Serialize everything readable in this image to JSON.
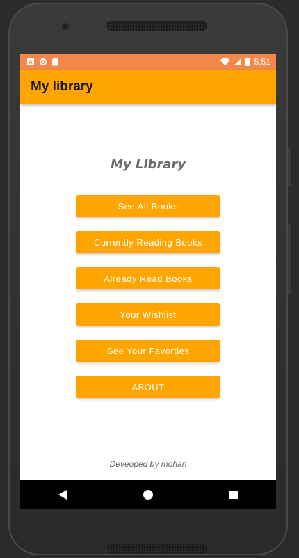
{
  "status_bar": {
    "time": "5:51",
    "left_icons": [
      "a-notification-icon",
      "record-icon",
      "sd-card-icon"
    ],
    "right_icons": [
      "wifi-icon",
      "signal-icon",
      "battery-icon"
    ]
  },
  "app_bar": {
    "title": "My library"
  },
  "main": {
    "heading": "My Library",
    "buttons": [
      "See All Books",
      "Currently Reading Books",
      "Already Read Books",
      "Your Wishlist",
      "See Your Favorties",
      "ABOUT"
    ],
    "footer": "Deveoped by mohan"
  },
  "nav_bar": {
    "icons": [
      "back-icon",
      "home-icon",
      "recent-apps-icon"
    ]
  },
  "colors": {
    "accent": "#ffa500",
    "status_bar": "#f4884a",
    "nav_bar": "#000000",
    "background": "#ffffff"
  }
}
